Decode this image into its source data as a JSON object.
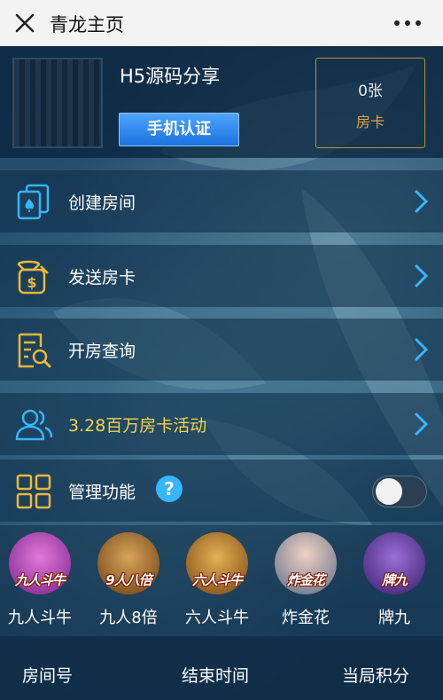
{
  "topbar": {
    "title": "青龙主页",
    "close_icon": "close-icon",
    "more_icon": "more-icon"
  },
  "profile": {
    "username": "H5源码分享",
    "verify_button": "手机认证",
    "room_card_count": "0张",
    "room_card_label": "房卡"
  },
  "menu": {
    "create_room": "创建房间",
    "send_card": "发送房卡",
    "room_query": "开房查询",
    "promotion": "3.28百万房卡活动",
    "admin": "管理功能",
    "help_glyph": "?"
  },
  "admin_toggle": {
    "on": false
  },
  "games": [
    {
      "logo_text": "九人斗牛",
      "name": "九人斗牛"
    },
    {
      "logo_text": "9人八倍",
      "name": "九人8倍"
    },
    {
      "logo_text": "六人斗牛",
      "name": "六人斗牛"
    },
    {
      "logo_text": "炸金花",
      "name": "炸金花"
    },
    {
      "logo_text": "牌九",
      "name": "牌九"
    }
  ],
  "table_header": {
    "room_no": "房间号",
    "end_time": "结束时间",
    "score": "当局积分"
  },
  "colors": {
    "accent_blue": "#35b6ff",
    "promo_gold": "#f4d34a",
    "card_border": "#b89235",
    "card_label": "#e2a43c",
    "background": "#214667"
  }
}
